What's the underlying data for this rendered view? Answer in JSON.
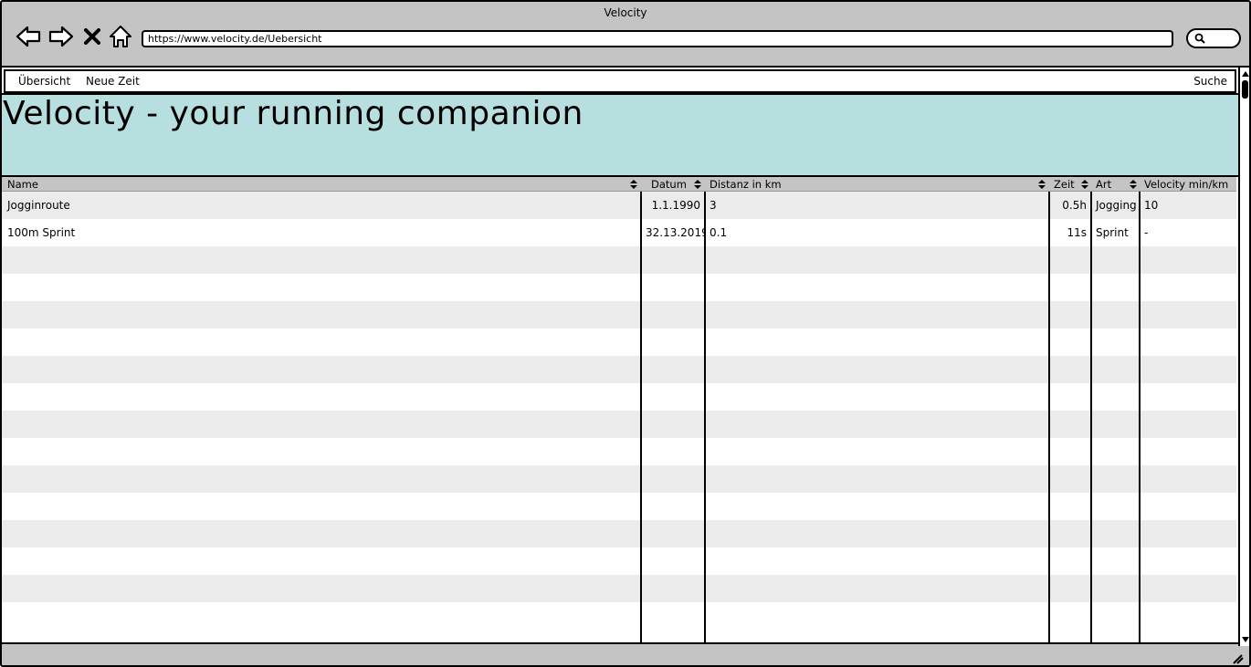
{
  "window": {
    "title": "Velocity"
  },
  "browser": {
    "url": "https://www.velocity.de/Uebersicht",
    "buttons": {
      "back": "back-icon",
      "forward": "forward-icon",
      "stop": "close-icon",
      "home": "home-icon"
    },
    "search_icon": "search-icon"
  },
  "nav": {
    "items": [
      "Übersicht",
      "Neue Zeit"
    ],
    "search_label": "Suche"
  },
  "hero": {
    "title": "Velocity - your running companion"
  },
  "table": {
    "columns": [
      "Name",
      "Datum",
      "Distanz in km",
      "Zeit",
      "Art",
      "Velocity min/km"
    ],
    "rows": [
      [
        "Jogginroute",
        "1.1.1990",
        "3",
        "0.5h",
        "Jogging",
        "10"
      ],
      [
        "100m Sprint",
        "32.13.2019",
        "0.1",
        "11s",
        "Sprint",
        "-"
      ]
    ],
    "striped_empty_rows": 14
  },
  "colors": {
    "chrome": "#c4c4c4",
    "hero": "#b8dfdf",
    "stripe": "#ebebeb",
    "border": "#000000"
  }
}
